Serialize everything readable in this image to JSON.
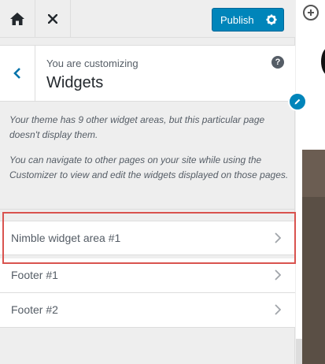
{
  "topbar": {
    "home_icon": "home-icon",
    "close_icon": "close-icon",
    "publish_label": "Publish",
    "publish_icon": "gear-icon"
  },
  "section": {
    "customizing_label": "You are customizing",
    "title": "Widgets",
    "back_icon": "chevron-left-icon",
    "help_label": "?"
  },
  "notice": {
    "line1": "Your theme has 9 other widget areas, but this particular page doesn't display them.",
    "line2": "You can navigate to other pages on your site while using the Customizer to view and edit the widgets displayed on those pages."
  },
  "widget_areas": [
    {
      "label": "Nimble widget area #1"
    },
    {
      "label": "Footer #1"
    },
    {
      "label": "Footer #2"
    }
  ],
  "colors": {
    "accent": "#0085ba",
    "highlight": "#d9534f"
  }
}
